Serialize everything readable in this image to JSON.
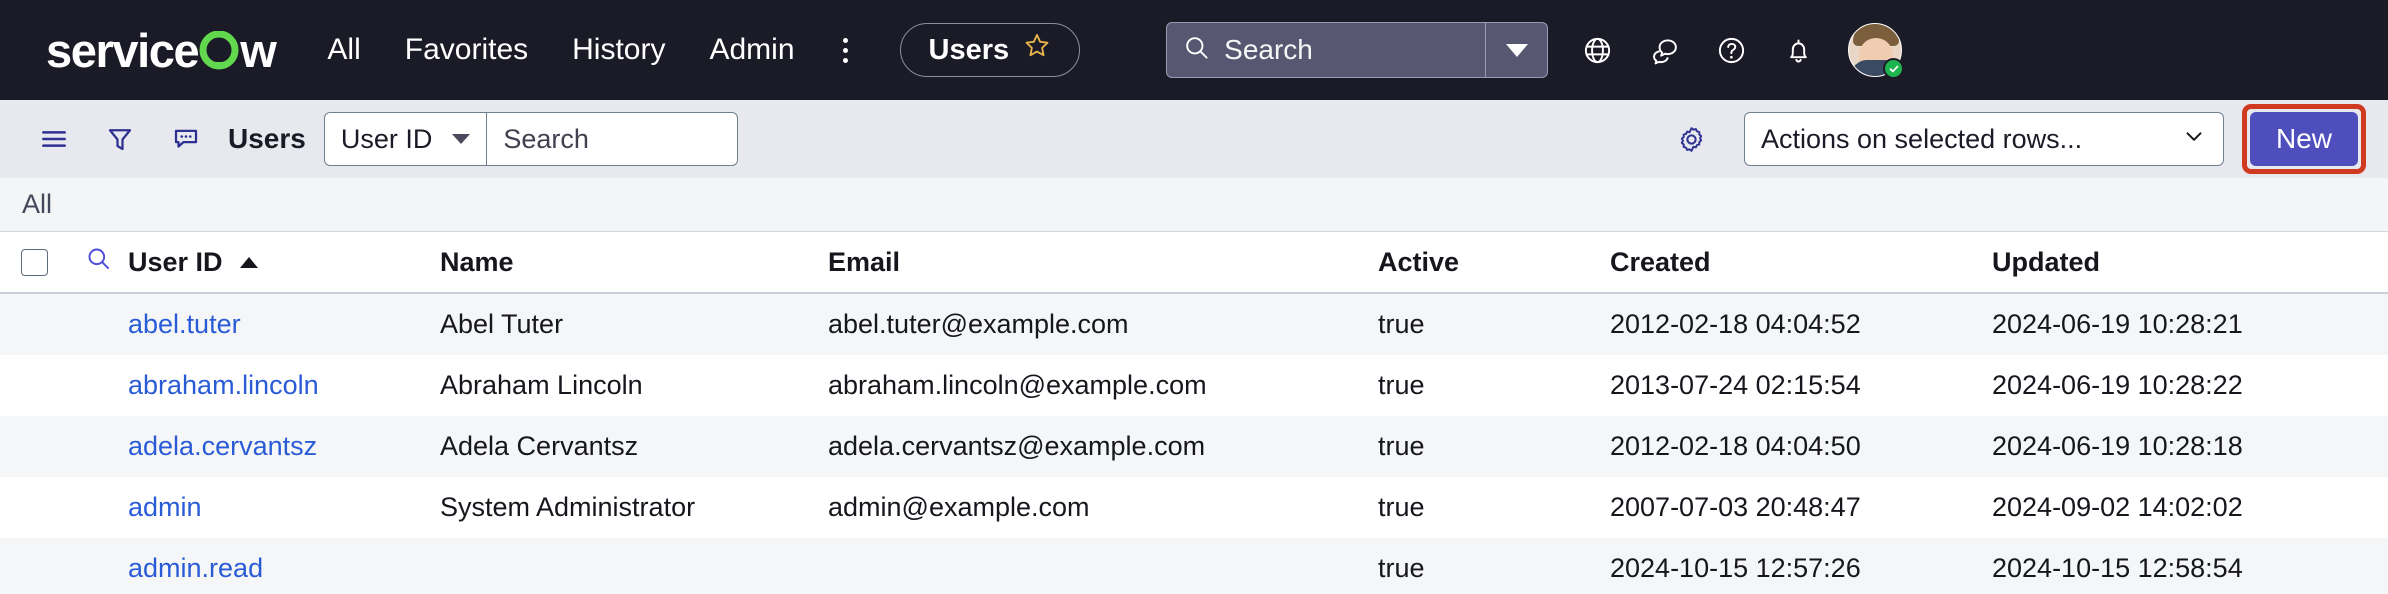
{
  "topnav": {
    "brand": "servicenow",
    "links": [
      {
        "label": "All",
        "name": "nav-link-all"
      },
      {
        "label": "Favorites",
        "name": "nav-link-favorites"
      },
      {
        "label": "History",
        "name": "nav-link-history"
      },
      {
        "label": "Admin",
        "name": "nav-link-admin"
      }
    ],
    "more_icon": "kebab-menu-icon",
    "tab": {
      "label": "Users",
      "favorite_icon": "star-outline-icon"
    },
    "search": {
      "placeholder": "Search",
      "value": "",
      "icon": "search-icon",
      "caret_icon": "caret-down-icon"
    },
    "icons": [
      {
        "name": "globe-icon",
        "label": "Language"
      },
      {
        "name": "conversations-icon",
        "label": "Conversations"
      },
      {
        "name": "help-icon",
        "label": "Help"
      },
      {
        "name": "notifications-bell-icon",
        "label": "Notifications"
      }
    ],
    "avatar": {
      "name": "user-avatar",
      "presence": "online"
    },
    "colors": {
      "background": "#1b1b28",
      "brand_accent": "#62d84e",
      "search_fill": "#585771"
    }
  },
  "toolbar": {
    "icons": [
      {
        "name": "list-menu-icon",
        "label": "Open list menu"
      },
      {
        "name": "filter-funnel-icon",
        "label": "Filter"
      },
      {
        "name": "comment-bubble-icon",
        "label": "Comments"
      }
    ],
    "title": "Users",
    "field_select": {
      "value": "User ID",
      "caret_icon": "caret-down-icon"
    },
    "search": {
      "placeholder": "Search",
      "value": ""
    },
    "gear_icon": "gear-icon",
    "actions_select": {
      "value": "Actions on selected rows...",
      "caret_icon": "chevron-down-icon"
    },
    "new_button": {
      "label": "New",
      "highlighted": true,
      "highlight_color": "#cf3a20",
      "fill_color": "#4e4fbd"
    }
  },
  "breadcrumb": {
    "items": [
      "All"
    ]
  },
  "table": {
    "columns": [
      {
        "key": "user_id",
        "label": "User ID",
        "sorted": "asc",
        "sort_icon": "sort-ascending-icon"
      },
      {
        "key": "name",
        "label": "Name"
      },
      {
        "key": "email",
        "label": "Email"
      },
      {
        "key": "active",
        "label": "Active"
      },
      {
        "key": "created",
        "label": "Created"
      },
      {
        "key": "updated",
        "label": "Updated"
      }
    ],
    "header_checkbox_name": "select-all-checkbox",
    "header_search_icon": "search-rows-icon",
    "rows": [
      {
        "user_id": "abel.tuter",
        "name": "Abel Tuter",
        "email": "abel.tuter@example.com",
        "active": "true",
        "created": "2012-02-18 04:04:52",
        "updated": "2024-06-19 10:28:21"
      },
      {
        "user_id": "abraham.lincoln",
        "name": "Abraham Lincoln",
        "email": "abraham.lincoln@example.com",
        "active": "true",
        "created": "2013-07-24 02:15:54",
        "updated": "2024-06-19 10:28:22"
      },
      {
        "user_id": "adela.cervantsz",
        "name": "Adela Cervantsz",
        "email": "adela.cervantsz@example.com",
        "active": "true",
        "created": "2012-02-18 04:04:50",
        "updated": "2024-06-19 10:28:18"
      },
      {
        "user_id": "admin",
        "name": "System Administrator",
        "email": "admin@example.com",
        "active": "true",
        "created": "2007-07-03 20:48:47",
        "updated": "2024-09-02 14:02:02"
      },
      {
        "user_id": "admin.read",
        "name": "",
        "email": "",
        "active": "true",
        "created": "2024-10-15 12:57:26",
        "updated": "2024-10-15 12:58:54"
      }
    ]
  }
}
